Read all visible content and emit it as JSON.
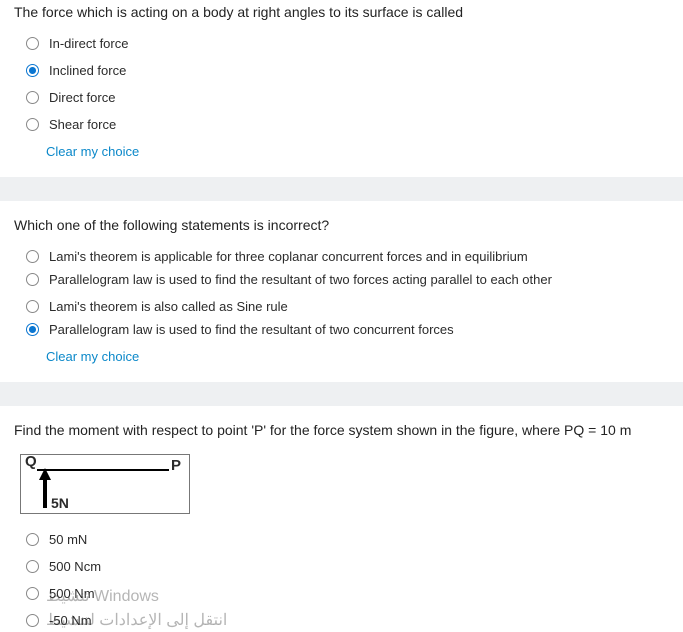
{
  "q1": {
    "text": "The force which is acting on a body at right angles to its surface is called",
    "options": [
      "In-direct force",
      "Inclined force",
      "Direct force",
      "Shear force"
    ],
    "selected_index": 1,
    "clear": "Clear my choice"
  },
  "q2": {
    "text": "Which one of the following statements is incorrect?",
    "options": [
      "Lami's theorem is applicable for three coplanar concurrent forces and in equilibrium",
      "Parallelogram law is used to find the resultant of two forces acting parallel to each other",
      "Lami's theorem is also called as Sine rule",
      "Parallelogram law is used to find the resultant of two concurrent forces"
    ],
    "selected_index": 3,
    "clear": "Clear my choice"
  },
  "q3": {
    "text": "Find the moment with respect to point 'P' for the force system shown in the figure, where PQ = 10 m",
    "figure": {
      "pointQ": "Q",
      "pointP": "P",
      "force": "5N"
    },
    "options": [
      "50 mN",
      "500 Ncm",
      "500 Nm",
      "-50 Nm"
    ],
    "selected_index": -1
  },
  "watermark": {
    "line1": "تنشيط Windows",
    "line2": "انتقل إلى الإعدادات لتنشيط"
  }
}
